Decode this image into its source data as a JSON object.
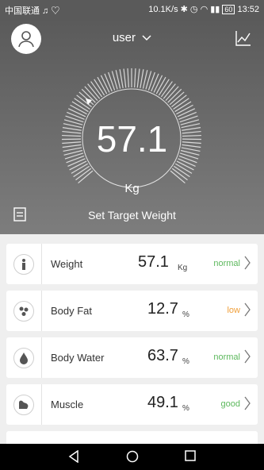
{
  "status_bar": {
    "carrier": "中国联通 ♫ ♡",
    "speed": "10.1K/s",
    "battery": "60",
    "time": "13:52"
  },
  "header": {
    "user": "user",
    "chevron": "chevron-down-icon",
    "trend_icon": "line-chart-icon"
  },
  "gauge": {
    "weight": "57.1",
    "unit": "Kg"
  },
  "target_label": "Set Target Weight",
  "metrics": [
    {
      "name": "Weight",
      "value": "57.1",
      "unit": "Kg",
      "status": "normal",
      "status_color": "#5cb85c",
      "icon": "person-icon"
    },
    {
      "name": "Body Fat",
      "value": "12.7",
      "unit": "%",
      "status": "low",
      "status_color": "#f0a03c",
      "icon": "fat-cells-icon"
    },
    {
      "name": "Body Water",
      "value": "63.7",
      "unit": "%",
      "status": "normal",
      "status_color": "#5cb85c",
      "icon": "water-drop-icon"
    },
    {
      "name": "Muscle",
      "value": "49.1",
      "unit": "%",
      "status": "good",
      "status_color": "#5cb85c",
      "icon": "muscle-arm-icon"
    }
  ]
}
